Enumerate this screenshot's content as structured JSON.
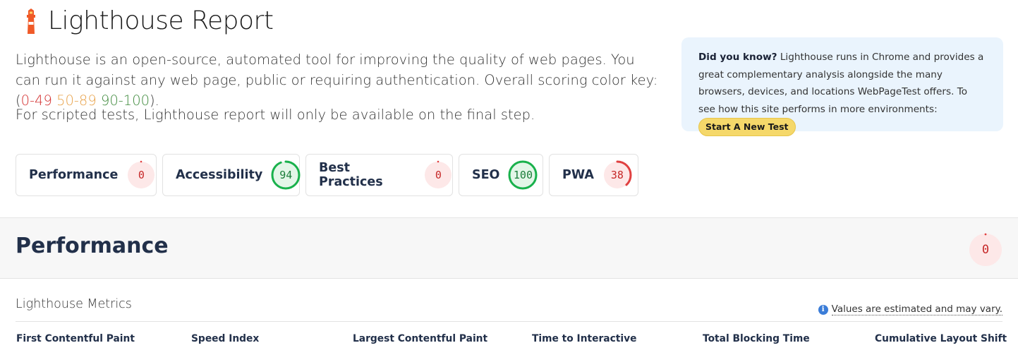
{
  "header": {
    "title": "Lighthouse Report",
    "icon": "lighthouse-icon"
  },
  "intro": {
    "text_before": "Lighthouse is an open-source, automated tool for improving the quality of web pages. You can run it against any web page, public or requiring authentication. Overall scoring color key: (",
    "range_poor": "0-49",
    "range_average": "50-89",
    "range_good": "90-100",
    "text_after": ").",
    "scripted_note": "For scripted tests, Lighthouse report will only be available on the final step."
  },
  "did_you_know": {
    "heading": "Did you know?",
    "body": "Lighthouse runs in Chrome and provides a great complementary analysis alongside the many browsers, devices, and locations WebPageTest offers. To see how this site performs in more environments:",
    "button_label": "Start A New Test"
  },
  "scores": [
    {
      "label": "Performance",
      "score": "0",
      "value": 0,
      "status": "poor"
    },
    {
      "label": "Accessibility",
      "score": "94",
      "value": 94,
      "status": "good"
    },
    {
      "label": "Best Practices",
      "score": "0",
      "value": 0,
      "status": "poor"
    },
    {
      "label": "SEO",
      "score": "100",
      "value": 100,
      "status": "good"
    },
    {
      "label": "PWA",
      "score": "38",
      "value": 38,
      "status": "poor"
    }
  ],
  "performance_section": {
    "title": "Performance",
    "score": "0",
    "value": 0
  },
  "metrics": {
    "title": "Lighthouse Metrics",
    "note": "Values are estimated and may vary.",
    "columns": [
      "First Contentful Paint",
      "Speed Index",
      "Largest Contentful Paint",
      "Time to Interactive",
      "Total Blocking Time",
      "Cumulative Layout Shift"
    ]
  },
  "colors": {
    "poor": "#c62828",
    "poor_fill": "#fde8e8",
    "poor_ring": "#e04040",
    "good": "#1b7d3a",
    "good_fill": "#e3f6e8",
    "good_ring": "#19b14c",
    "callout_bg": "#eaf4fd",
    "cta_bg": "#f5d86a"
  }
}
